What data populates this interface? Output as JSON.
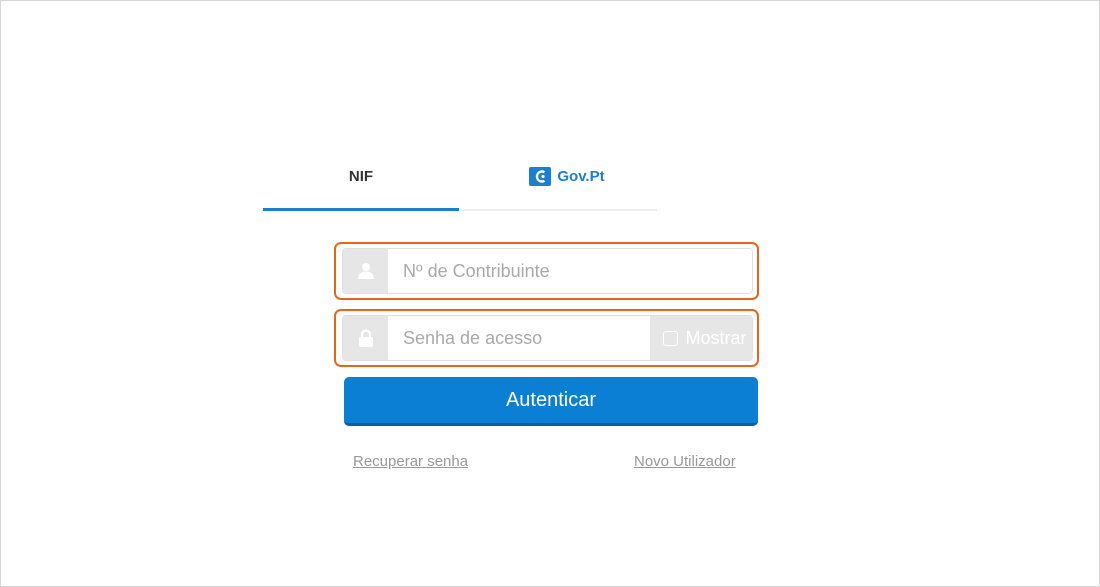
{
  "tabs": {
    "nif_label": "NIF",
    "gov_label": "Gov.Pt",
    "active": "NIF"
  },
  "form": {
    "nif_placeholder": "Nº de Contribuinte",
    "password_placeholder": "Senha de acesso",
    "show_label": "Mostrar",
    "submit_label": "Autenticar"
  },
  "links": {
    "recover": "Recuperar senha",
    "new_user": "Novo Utilizador"
  },
  "icons": {
    "user_field": "user-icon",
    "password_field": "lock-icon",
    "gov_logo": "gov-pt-logo-icon"
  },
  "colors": {
    "accent": "#1b7fd0",
    "button": "#0a7fd4",
    "highlight_border": "#e4661b",
    "addon_bg": "#e6e6e6",
    "link": "#999999"
  }
}
